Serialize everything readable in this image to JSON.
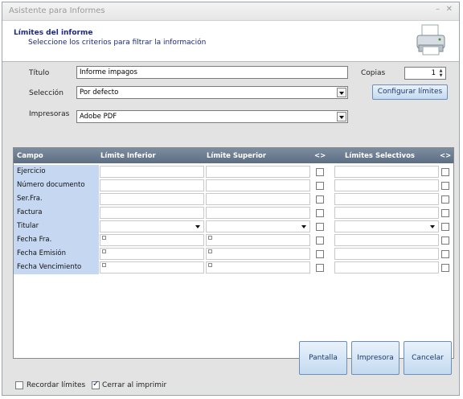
{
  "window": {
    "title": "Asistente para Informes",
    "controls": [
      "–",
      "✕"
    ]
  },
  "header": {
    "title": "Límites del informe",
    "subtitle": "Seleccione los criterios para filtrar la información",
    "icon": "printer-icon"
  },
  "form": {
    "titulo_label": "Título",
    "titulo_value": "Informe impagos",
    "seleccion_label": "Selección",
    "seleccion_value": "Por defecto",
    "impresoras_label": "Impresoras",
    "impresoras_value": "Adobe PDF",
    "copias_label": "Copias",
    "copias_value": "1",
    "configurar_label": "Configurar límites"
  },
  "grid": {
    "columns": [
      "Campo",
      "Límite Inferior",
      "Límite Superior",
      "<>",
      "Límites Selectivos",
      "<>"
    ],
    "rows": [
      {
        "label": "Ejercicio",
        "kind": "text"
      },
      {
        "label": "Número documento",
        "kind": "text"
      },
      {
        "label": "Ser.Fra.",
        "kind": "text"
      },
      {
        "label": "Factura",
        "kind": "text"
      },
      {
        "label": "Titular",
        "kind": "dropdown"
      },
      {
        "label": "Fecha Fra.",
        "kind": "date"
      },
      {
        "label": "Fecha Emisión",
        "kind": "date"
      },
      {
        "label": "Fecha Vencimiento",
        "kind": "date"
      }
    ]
  },
  "footer": {
    "recordar_label": "Recordar límites",
    "recordar_checked": false,
    "cerrar_label": "Cerrar al imprimir",
    "cerrar_checked": true,
    "pantalla_label": "Pantalla",
    "impresora_label": "Impresora",
    "cancelar_label": "Cancelar"
  }
}
